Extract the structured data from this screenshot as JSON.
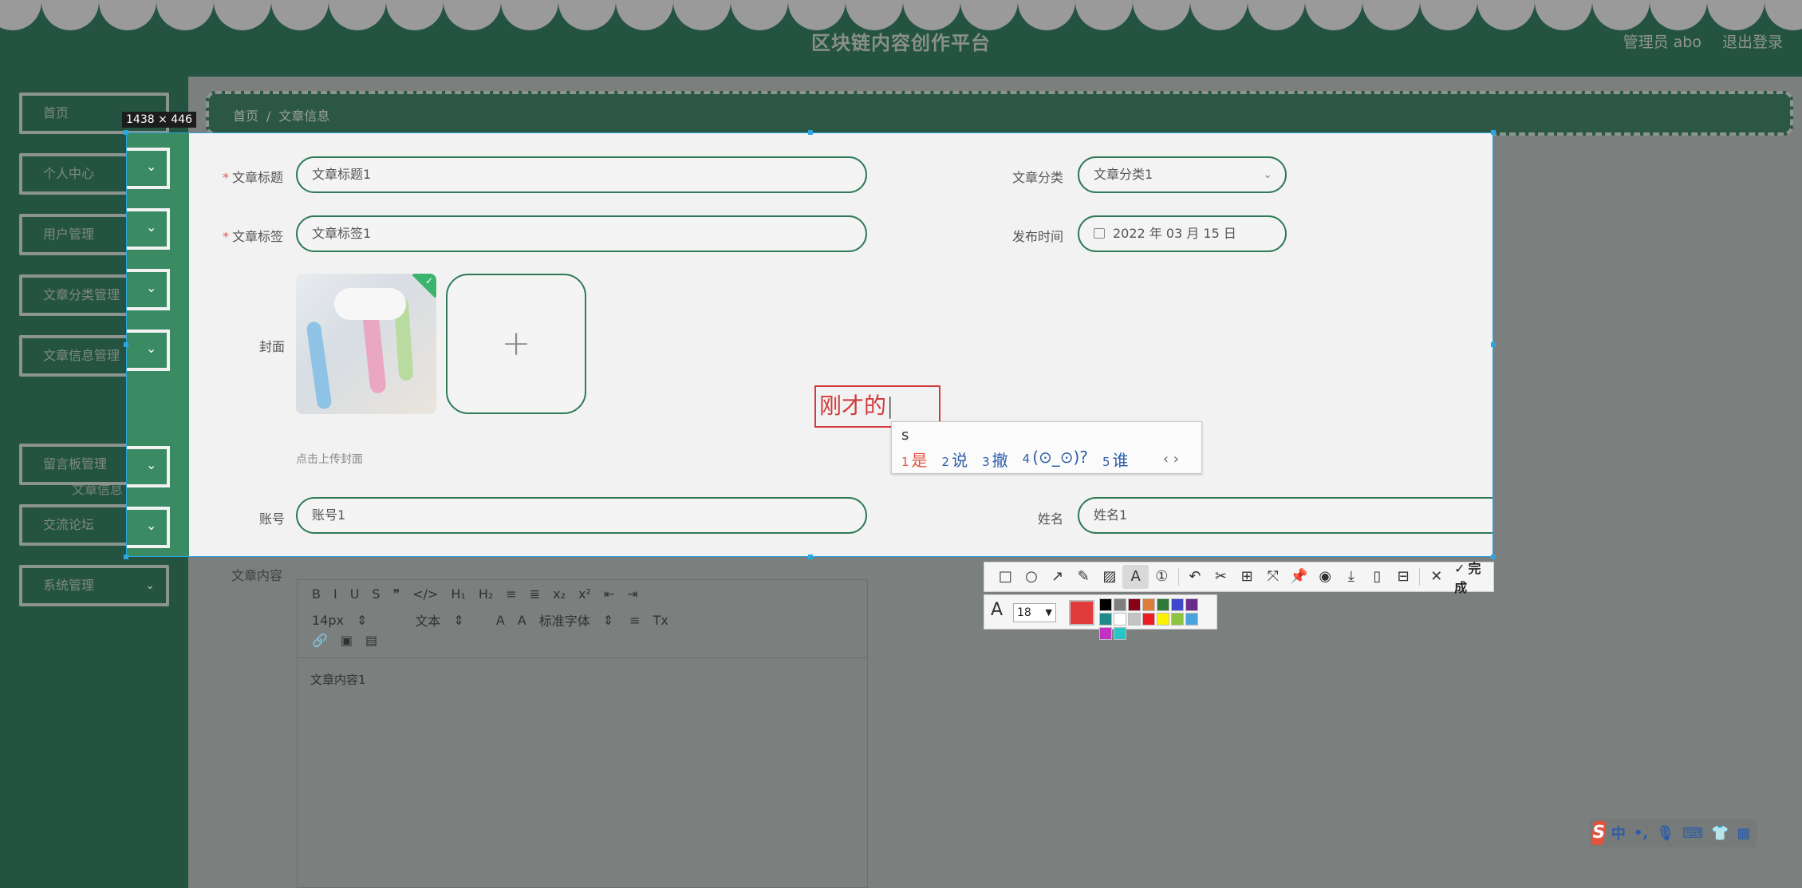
{
  "header": {
    "title": "区块链内容创作平台",
    "user": "管理员 abo",
    "logout": "退出登录"
  },
  "sidebar": {
    "items": [
      {
        "label": "首页"
      },
      {
        "label": "个人中心"
      },
      {
        "label": "用户管理"
      },
      {
        "label": "文章分类管理"
      },
      {
        "label": "文章信息管理"
      },
      {
        "label": "留言板管理"
      },
      {
        "label": "交流论坛"
      },
      {
        "label": "系统管理"
      }
    ],
    "sub_item": "文章信息"
  },
  "breadcrumb": {
    "home": "首页",
    "sep": "/",
    "current": "文章信息"
  },
  "form": {
    "title_label": "文章标题",
    "title_value": "文章标题1",
    "category_label": "文章分类",
    "category_value": "文章分类1",
    "tag_label": "文章标签",
    "tag_value": "文章标签1",
    "publish_label": "发布时间",
    "publish_value": "2022 年 03 月 15 日",
    "cover_label": "封面",
    "upload_hint": "点击上传封面",
    "account_label": "账号",
    "account_value": "账号1",
    "name_label": "姓名",
    "name_value": "姓名1",
    "content_label": "文章内容",
    "content_value": "文章内容1",
    "required_mark": "*"
  },
  "editor": {
    "row1": [
      "B",
      "I",
      "U",
      "S",
      "❞",
      "</>",
      "H₁",
      "H₂",
      "≡",
      "≣",
      "x₂",
      "x²",
      "⇤",
      "⇥"
    ],
    "font_size": "14px",
    "block": "文本",
    "font_family": "标准字体",
    "row2_icons": [
      "A",
      "A",
      "≡",
      "Tx"
    ]
  },
  "screenshot_tool": {
    "size_tag": "1438 × 446",
    "annotation_text": "刚才的",
    "ime_input": "s",
    "ime_candidates": [
      {
        "n": "1",
        "t": "是"
      },
      {
        "n": "2",
        "t": "说"
      },
      {
        "n": "3",
        "t": "撤"
      },
      {
        "n": "4",
        "t": "(⊙_⊙)?"
      },
      {
        "n": "5",
        "t": "谁"
      }
    ],
    "ime_nav": "‹ ›",
    "done": "完成",
    "font_size": "18",
    "current_color": "#e23b3b",
    "palette": [
      "#000000",
      "#7f7f7f",
      "#880015",
      "#e07b39",
      "#2f7a3a",
      "#3f48cc",
      "#6a2c8a",
      "#1f8a8a",
      "#ffffff",
      "#c3c3c3",
      "#ed1c24",
      "#fff200",
      "#8ec43f",
      "#4aa3df",
      "#c330c3",
      "#26c6c6"
    ]
  },
  "ime_bar": {
    "logo": "S",
    "mode": "中",
    "punct": "•,",
    "icons": [
      "mic-icon",
      "keyboard-icon",
      "shirt-icon",
      "apps-icon"
    ]
  }
}
